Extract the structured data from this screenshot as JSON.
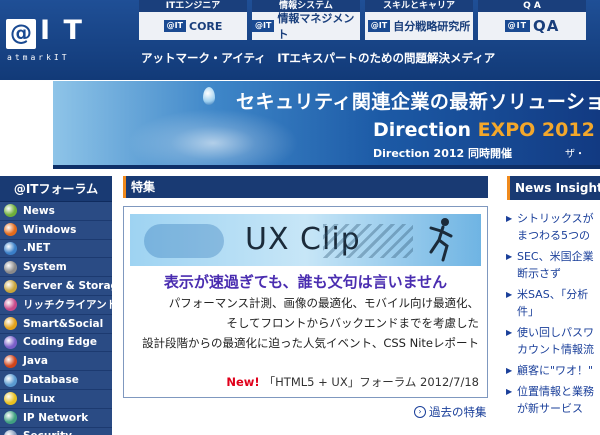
{
  "header": {
    "logo_badge": "@",
    "logo_it": "I T",
    "logo_sub": "atmarkIT",
    "tagline": "アットマーク・アイティ　ITエキスパートのための問題解決メディア",
    "tabs": [
      {
        "cap": "ITエンジニア",
        "badge": "@IT",
        "label": "CORE"
      },
      {
        "cap": "情報システム",
        "badge": "@IT",
        "label": "情報マネジメント"
      },
      {
        "cap": "スキルとキャリア",
        "badge": "@IT",
        "label": "自分戦略研究所"
      },
      {
        "cap": "Q A",
        "badge": "@IT",
        "label": "QA"
      }
    ]
  },
  "banner": {
    "headline": "セキュリティ関連企業の最新ソリューションや",
    "expo_main": "Direction ",
    "expo_accent": "EXPO 2012",
    "sub": "Direction 2012 同時開催",
    "sub2": "ザ・"
  },
  "leftnav": {
    "title": "@ITフォーラム",
    "items": [
      {
        "label": "News",
        "color": "#6fae3a"
      },
      {
        "label": "Windows",
        "color": "#e26a1b"
      },
      {
        "label": ".NET",
        "color": "#3a7fc8"
      },
      {
        "label": "System",
        "color": "#8a8a8a"
      },
      {
        "label": "Server & Storage",
        "color": "#c8a43a"
      },
      {
        "label": "リッチクライアント",
        "color": "#c84a8a"
      },
      {
        "label": "Smart&Social",
        "color": "#e2a21b"
      },
      {
        "label": "Coding Edge",
        "color": "#7a5fc8"
      },
      {
        "label": "Java",
        "color": "#d0451b"
      },
      {
        "label": "Database",
        "color": "#5a9ad0"
      },
      {
        "label": "Linux",
        "color": "#e8c020"
      },
      {
        "label": "IP Network",
        "color": "#40a080"
      },
      {
        "label": "Security",
        "color": "#8aa0c0"
      }
    ]
  },
  "feature": {
    "head": "特集",
    "banner_word": "UX Clip",
    "title": "表示が速過ぎても、誰も文句は言いません",
    "desc": [
      "パフォーマンス計測、画像の最適化、モバイル向け最適化、",
      "そしてフロントからバックエンドまでを考慮した",
      "設計段階からの最適化に迫った人気イベント、CSS Niteレポート"
    ],
    "new_label": "New!",
    "foot": "「HTML5 + UX」フォーラム 2012/7/18",
    "past_link": "過去の特集"
  },
  "news": {
    "head": "News Insight",
    "items": [
      {
        "lines": [
          "シトリックスが",
          "まつわる5つの"
        ],
        "red": false
      },
      {
        "lines": [
          "SEC、米国企業",
          "断示さず"
        ],
        "red": false
      },
      {
        "lines": [
          "米SAS、「分析",
          "件」"
        ],
        "red": false
      },
      {
        "lines": [
          "使い回しパスワ",
          "カウント情報流"
        ],
        "red": false
      },
      {
        "lines": [
          "顧客に\"ワオ！\""
        ],
        "red": false
      },
      {
        "lines": [
          "位置情報と業務",
          "が新サービス"
        ],
        "red": false
      }
    ]
  }
}
